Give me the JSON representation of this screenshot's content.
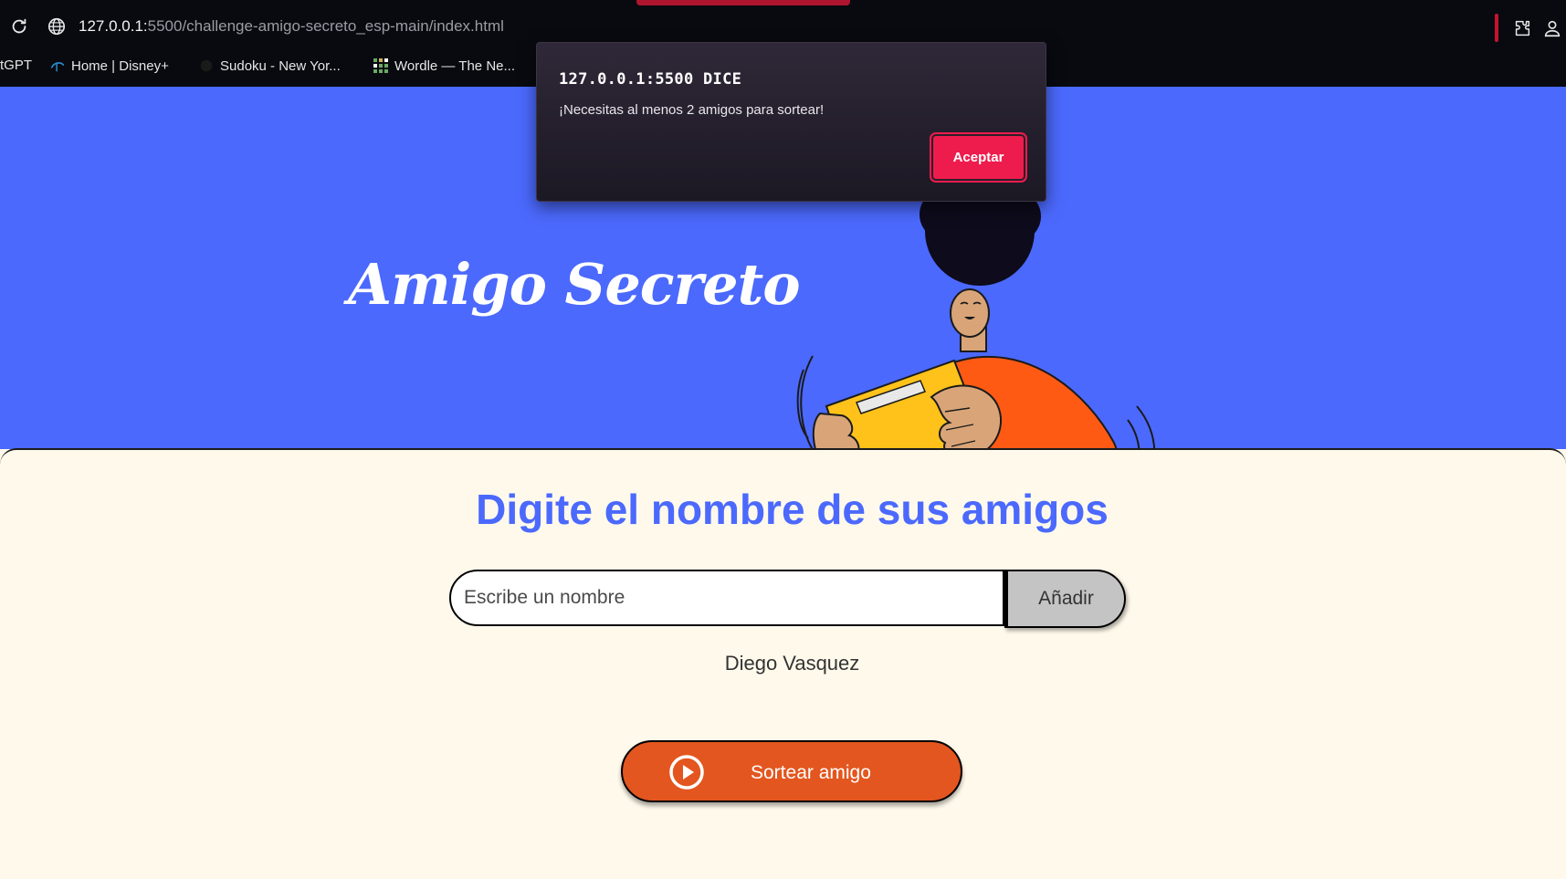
{
  "browser": {
    "url_host": "127.0.0.1:",
    "url_path": "5500/challenge-amigo-secreto_esp-main/index.html",
    "bookmarks": [
      {
        "label": "tGPT",
        "icon": "none"
      },
      {
        "label": "Home | Disney+",
        "icon": "disney-icon"
      },
      {
        "label": "Sudoku - New Yor...",
        "icon": "nyt-icon"
      },
      {
        "label": "Wordle — The Ne...",
        "icon": "wordle-grid-icon"
      }
    ],
    "accent_color": "#b0152f"
  },
  "hero": {
    "title": "Amigo Secreto",
    "background_color": "#4b69fd"
  },
  "main": {
    "title": "Digite el nombre de sus amigos",
    "input": {
      "placeholder": "Escribe un nombre",
      "value": ""
    },
    "add_button_label": "Añadir",
    "friends": [
      "Diego Vasquez"
    ],
    "draw_button_label": "Sortear amigo",
    "draw_button_color": "#e3561f"
  },
  "dialog": {
    "title": "127.0.0.1:5500 DICE",
    "message": "¡Necesitas al menos 2 amigos para sortear!",
    "accept_label": "Aceptar",
    "accept_color": "#ee1c4d"
  }
}
